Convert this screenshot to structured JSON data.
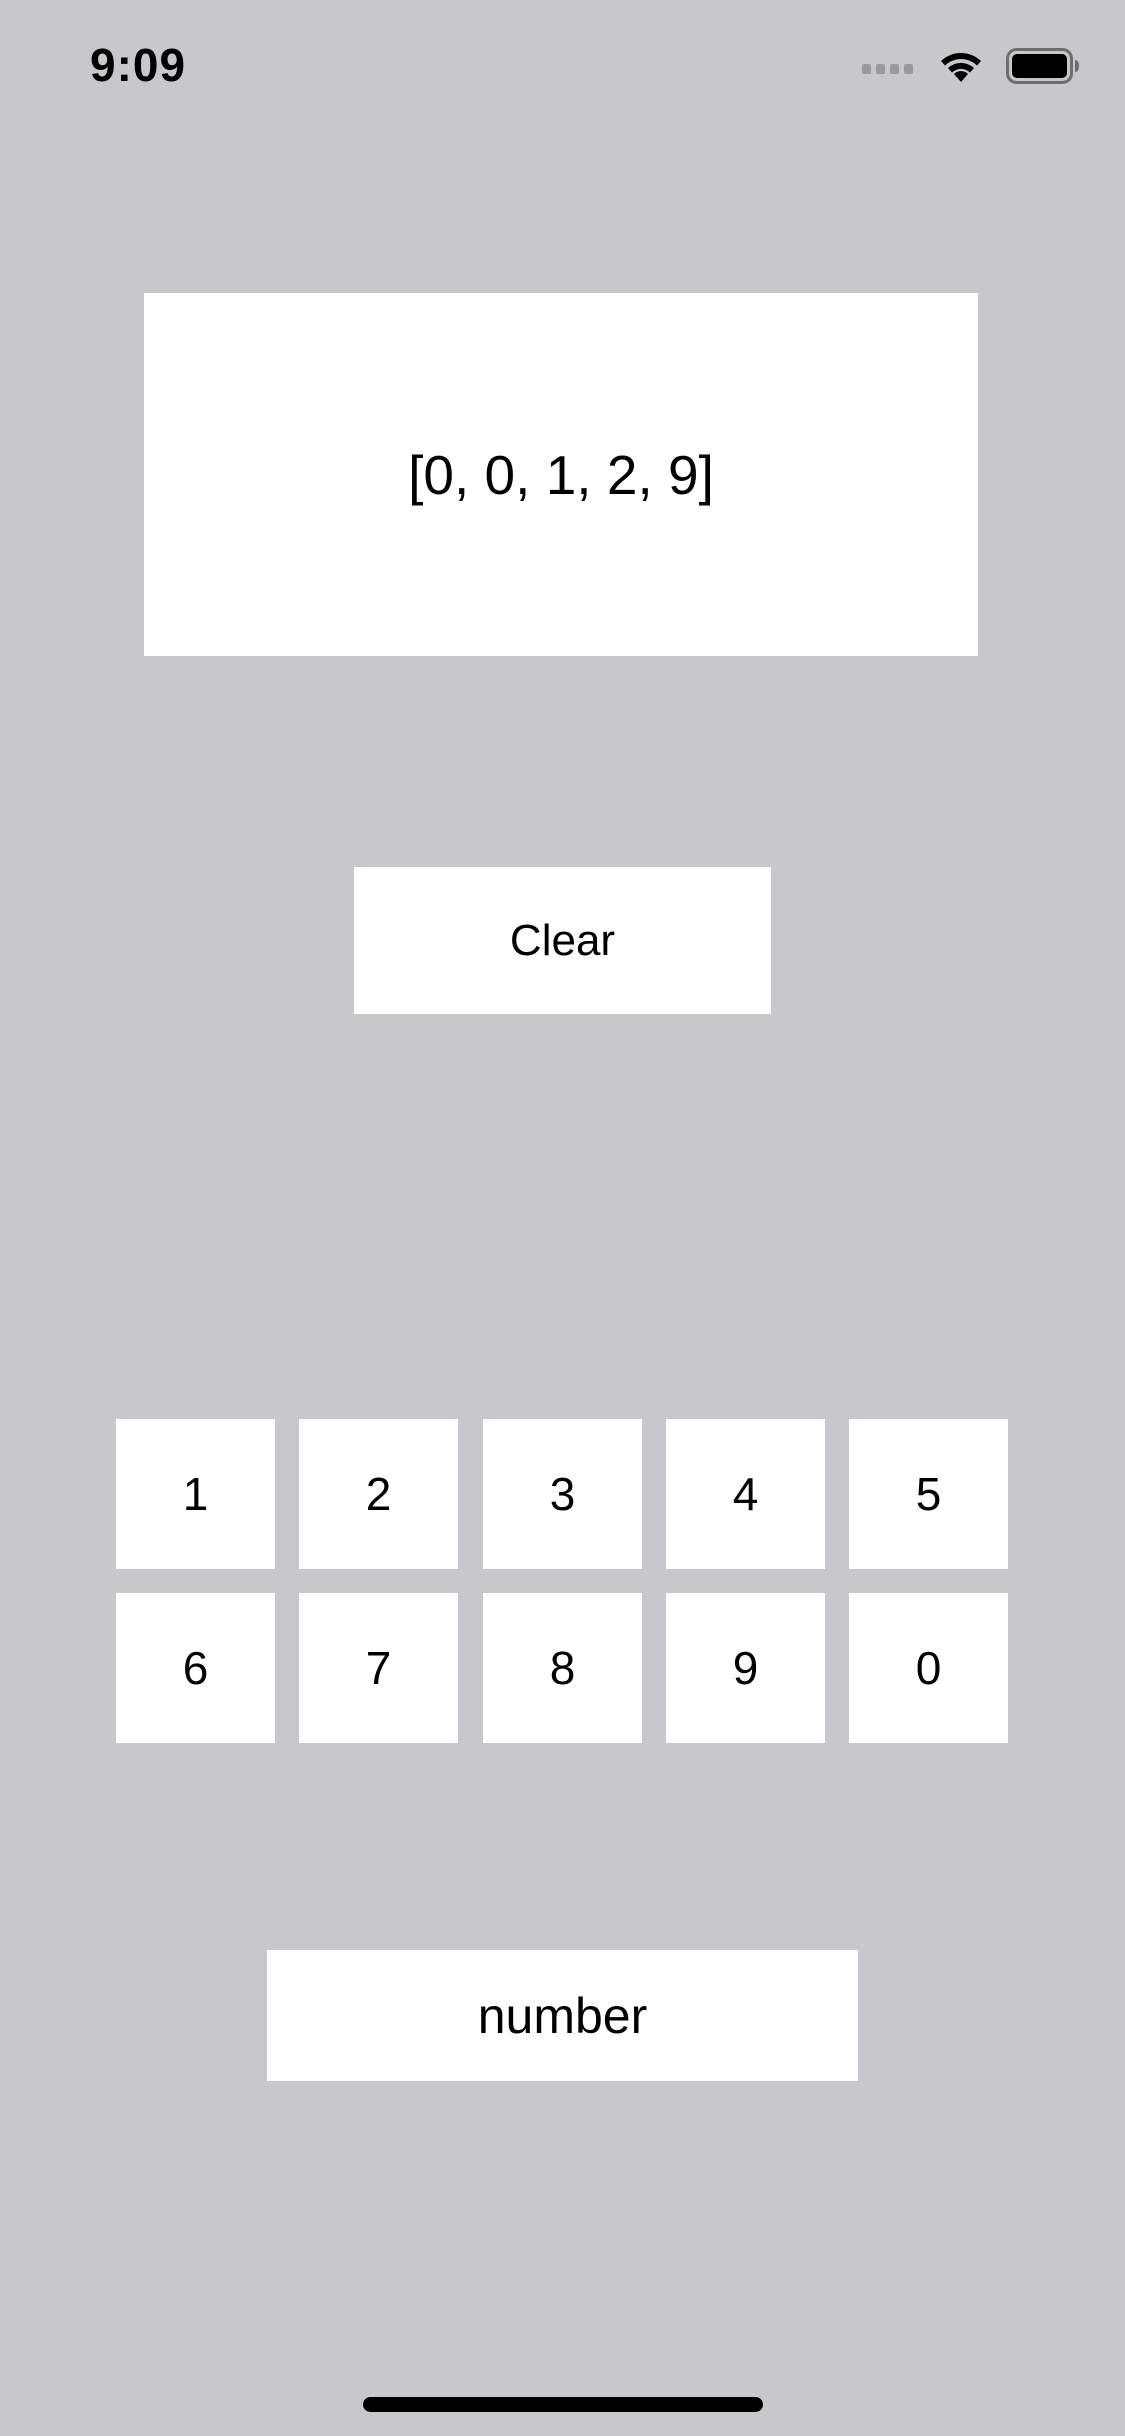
{
  "status_bar": {
    "time": "9:09",
    "icons": [
      "cellular-signal-icon",
      "wifi-icon",
      "battery-icon"
    ]
  },
  "display": {
    "value": "[0, 0, 1, 2, 9]"
  },
  "clear_button": {
    "label": "Clear"
  },
  "keypad": {
    "keys": [
      "1",
      "2",
      "3",
      "4",
      "5",
      "6",
      "7",
      "8",
      "9",
      "0"
    ]
  },
  "number_button": {
    "label": "number"
  },
  "colors": {
    "background": "#c8c7cc",
    "surface": "#ffffff",
    "text": "#000000"
  }
}
